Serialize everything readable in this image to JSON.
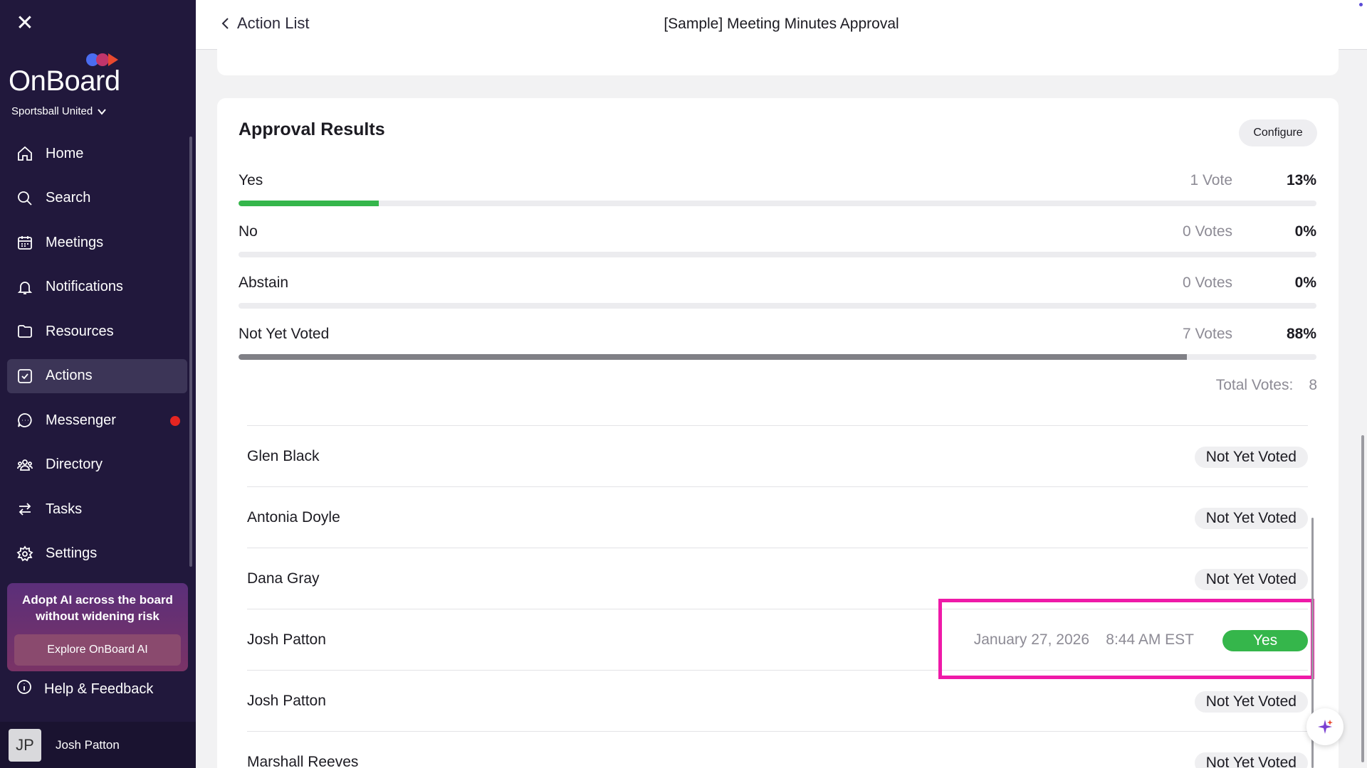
{
  "sidebar": {
    "logo_text": "OnBoard",
    "org_name": "Sportsball United",
    "nav": [
      {
        "label": "Home",
        "icon": "home-icon"
      },
      {
        "label": "Search",
        "icon": "search-icon"
      },
      {
        "label": "Meetings",
        "icon": "calendar-icon"
      },
      {
        "label": "Notifications",
        "icon": "bell-icon"
      },
      {
        "label": "Resources",
        "icon": "folder-icon"
      },
      {
        "label": "Actions",
        "icon": "checkbox-icon",
        "active": true
      },
      {
        "label": "Messenger",
        "icon": "chat-icon",
        "unread": true
      },
      {
        "label": "Directory",
        "icon": "people-icon"
      },
      {
        "label": "Tasks",
        "icon": "swap-arrows-icon"
      },
      {
        "label": "Settings",
        "icon": "gear-icon"
      }
    ],
    "promo": {
      "text_line1": "Adopt AI across the board",
      "text_line2": "without widening risk",
      "button": "Explore OnBoard AI"
    },
    "help_label": "Help & Feedback",
    "user": {
      "initials": "JP",
      "name": "Josh Patton"
    }
  },
  "header": {
    "back_label": "Action List",
    "title": "[Sample] Meeting Minutes Approval"
  },
  "results": {
    "title": "Approval Results",
    "configure_label": "Configure",
    "options": [
      {
        "label": "Yes",
        "votes": "1 Vote",
        "pct": "13%",
        "fraction": 0.13,
        "color": "#35b64b"
      },
      {
        "label": "No",
        "votes": "0 Votes",
        "pct": "0%",
        "fraction": 0,
        "color": "#8a8a90"
      },
      {
        "label": "Abstain",
        "votes": "0 Votes",
        "pct": "0%",
        "fraction": 0,
        "color": "#8a8a90"
      },
      {
        "label": "Not Yet Voted",
        "votes": "7 Votes",
        "pct": "88%",
        "fraction": 0.88,
        "color": "#808086"
      }
    ],
    "total_label": "Total Votes:",
    "total_value": "8"
  },
  "voters": [
    {
      "name": "Glen Black",
      "status": "Not Yet Voted"
    },
    {
      "name": "Antonia Doyle",
      "status": "Not Yet Voted"
    },
    {
      "name": "Dana Gray",
      "status": "Not Yet Voted"
    },
    {
      "name": "Josh Patton",
      "status": "Yes",
      "date": "January 27, 2026",
      "time": "8:44 AM EST"
    },
    {
      "name": "Josh Patton",
      "status": "Not Yet Voted"
    },
    {
      "name": "Marshall Reeves",
      "status": "Not Yet Voted"
    }
  ]
}
